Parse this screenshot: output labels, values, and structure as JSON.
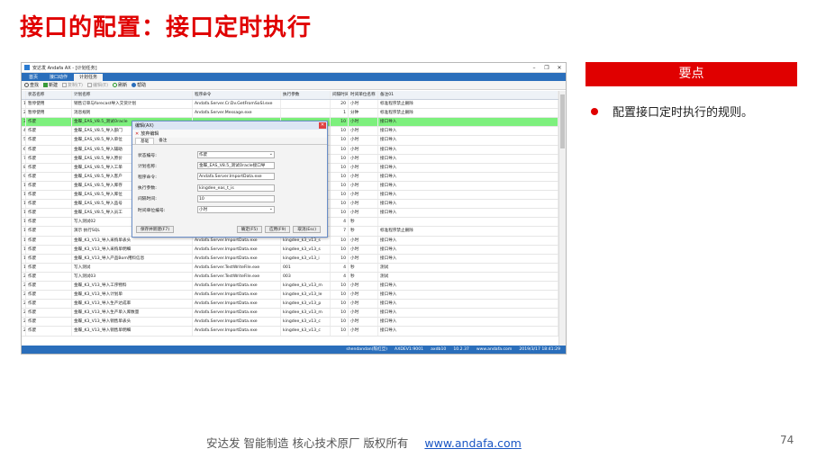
{
  "slide_title": "接口的配置：接口定时执行",
  "app": {
    "window_title": "安达发 Andafa AX - [计划任务]",
    "menu_tabs": [
      "首页",
      "接口动作",
      "计划任务"
    ],
    "toolbar": [
      "查找",
      "新建",
      "复制(T)",
      "编辑(E)",
      "刷新",
      "帮助"
    ],
    "columns": [
      "状态名称",
      "计划名称",
      "程序命令",
      "执行参数",
      "间隔时间",
      "时间单位名称",
      "备注01"
    ],
    "rows": [
      {
        "no": "1",
        "status": "暂停使用",
        "name": "销售订单与forecast导入交货计划",
        "cmd": "Andafa.Server.Cr.Dv.GetFromSoSI.exe",
        "param": "",
        "interval": "20",
        "unit": "小时",
        "note": "标准程序禁止删除"
      },
      {
        "no": "2",
        "status": "暂停使用",
        "name": "消息规则",
        "cmd": "Andafa.Server.Message.exe",
        "param": "",
        "interval": "1",
        "unit": "分钟",
        "note": "标准程序禁止删除"
      },
      {
        "no": "3",
        "status": "作废",
        "name": "金蝶_EAS_V8.5_测试Oracle",
        "cmd": "",
        "param": "",
        "interval": "10",
        "unit": "小时",
        "note": "接口导入"
      },
      {
        "no": "4",
        "status": "作废",
        "name": "金蝶_EAS_V8.5_导入部门",
        "cmd": "",
        "param": "",
        "interval": "10",
        "unit": "小时",
        "note": "接口导入"
      },
      {
        "no": "5",
        "status": "作废",
        "name": "金蝶_EAS_V8.5_导入单位",
        "cmd": "",
        "param": "",
        "interval": "10",
        "unit": "小时",
        "note": "接口导入"
      },
      {
        "no": "6",
        "status": "作废",
        "name": "金蝶_EAS_V8.5_导入辅助",
        "cmd": "",
        "param": "",
        "interval": "10",
        "unit": "小时",
        "note": "接口导入"
      },
      {
        "no": "7",
        "status": "作废",
        "name": "金蝶_EAS_V8.5_导入原价",
        "cmd": "",
        "param": "",
        "interval": "10",
        "unit": "小时",
        "note": "接口导入"
      },
      {
        "no": "8",
        "status": "作废",
        "name": "金蝶_EAS_V8.5_导入工单",
        "cmd": "",
        "param": "",
        "interval": "10",
        "unit": "小时",
        "note": "接口导入"
      },
      {
        "no": "9",
        "status": "作废",
        "name": "金蝶_EAS_V8.5_导入客户",
        "cmd": "",
        "param": "",
        "interval": "10",
        "unit": "小时",
        "note": "接口导入"
      },
      {
        "no": "10",
        "status": "作废",
        "name": "金蝶_EAS_V8.5_导入库存",
        "cmd": "",
        "param": "",
        "interval": "10",
        "unit": "小时",
        "note": "接口导入"
      },
      {
        "no": "11",
        "status": "作废",
        "name": "金蝶_EAS_V8.5_导入库位",
        "cmd": "",
        "param": "",
        "interval": "10",
        "unit": "小时",
        "note": "接口导入"
      },
      {
        "no": "12",
        "status": "作废",
        "name": "金蝶_EAS_V8.5_导入品号",
        "cmd": "",
        "param": "",
        "interval": "10",
        "unit": "小时",
        "note": "接口导入"
      },
      {
        "no": "13",
        "status": "作废",
        "name": "金蝶_EAS_V8.5_导入员工",
        "cmd": "",
        "param": "",
        "interval": "10",
        "unit": "小时",
        "note": "接口导入"
      },
      {
        "no": "14",
        "status": "作废",
        "name": "写入测试02",
        "cmd": "",
        "param": "",
        "interval": "4",
        "unit": "秒",
        "note": ""
      },
      {
        "no": "15",
        "status": "作废",
        "name": "演示 执行SQL",
        "cmd": "",
        "param": "",
        "interval": "7",
        "unit": "秒",
        "note": "标准程序禁止删除"
      },
      {
        "no": "16",
        "status": "作废",
        "name": "金蝶_K3_V13_导入采购单表头",
        "cmd": "Andafa.Server.ImportData.exe",
        "param": "kingdee_k3_v13_s",
        "interval": "10",
        "unit": "小时",
        "note": "接口导入"
      },
      {
        "no": "17",
        "status": "作废",
        "name": "金蝶_K3_V13_导入采购单明细",
        "cmd": "Andafa.Server.ImportData.exe",
        "param": "kingdee_k3_v13_s",
        "interval": "10",
        "unit": "小时",
        "note": "接口导入"
      },
      {
        "no": "18",
        "status": "作废",
        "name": "金蝶_K3_V13_导入产品Bom用料信息",
        "cmd": "Andafa.Server.ImportData.exe",
        "param": "kingdee_k3_v13_i",
        "interval": "10",
        "unit": "小时",
        "note": "接口导入"
      },
      {
        "no": "19",
        "status": "作废",
        "name": "写入测试",
        "cmd": "Andafa.Server.TestWriteFile.exe",
        "param": "001",
        "interval": "4",
        "unit": "秒",
        "note": "测试"
      },
      {
        "no": "20",
        "status": "作废",
        "name": "写入测试03",
        "cmd": "Andafa.Server.TestWriteFile.exe",
        "param": "003",
        "interval": "4",
        "unit": "秒",
        "note": "测试"
      },
      {
        "no": "21",
        "status": "作废",
        "name": "金蝶_K3_V13_导入工序物料",
        "cmd": "Andafa.Server.ImportData.exe",
        "param": "kingdee_k3_v13_m",
        "interval": "10",
        "unit": "小时",
        "note": "接口导入"
      },
      {
        "no": "22",
        "status": "作废",
        "name": "金蝶_K3_V13_导入计划单",
        "cmd": "Andafa.Server.ImportData.exe",
        "param": "kingdee_k3_v13_le",
        "interval": "10",
        "unit": "小时",
        "note": "接口导入"
      },
      {
        "no": "23",
        "status": "作废",
        "name": "金蝶_K3_V13_导入生产达成率",
        "cmd": "Andafa.Server.ImportData.exe",
        "param": "kingdee_k3_v13_p",
        "interval": "10",
        "unit": "小时",
        "note": "接口导入"
      },
      {
        "no": "24",
        "status": "作废",
        "name": "金蝶_K3_V13_导入生产单入库数量",
        "cmd": "Andafa.Server.ImportData.exe",
        "param": "kingdee_k3_v13_m",
        "interval": "10",
        "unit": "小时",
        "note": "接口导入"
      },
      {
        "no": "25",
        "status": "作废",
        "name": "金蝶_K3_V13_导入销售单表头",
        "cmd": "Andafa.Server.ImportData.exe",
        "param": "kingdee_k3_v13_c",
        "interval": "10",
        "unit": "小时",
        "note": "接口导入"
      },
      {
        "no": "26",
        "status": "作废",
        "name": "金蝶_K3_V13_导入销售单明细",
        "cmd": "Andafa.Server.ImportData.exe",
        "param": "kingdee_k3_v13_c",
        "interval": "10",
        "unit": "小时",
        "note": "接口导入"
      }
    ],
    "status_bar": [
      "shendandan(陈红旦)",
      "AXDEV1:9001",
      "axdb10",
      "10.2.37",
      "www.andafa.com",
      "2019/3/17 18:41:29"
    ],
    "dialog": {
      "title": "编辑(AX)",
      "toolbar_action": "放弃编辑",
      "tabs": [
        "基础",
        "备注"
      ],
      "fields": [
        {
          "label": "状态编号:",
          "value": "作废",
          "dropdown": true
        },
        {
          "label": "计划名称:",
          "value": "金蝶_EAS_V8.5_测试Oracle接口导",
          "dropdown": false
        },
        {
          "label": "程序命令:",
          "value": "Andafa.Server.ImportData.exe",
          "dropdown": false
        },
        {
          "label": "执行参数:",
          "value": "kingdee_eas_t_is",
          "dropdown": false
        },
        {
          "label": "间隔时间:",
          "value": "10",
          "dropdown": false
        },
        {
          "label": "时间单位编号:",
          "value": "小时",
          "dropdown": true
        }
      ],
      "buttons": [
        "保存并新建(F7)",
        "确定(F5)",
        "应用(F9)",
        "取消(Esc)"
      ]
    }
  },
  "right_panel": {
    "header": "要点",
    "bullet": "配置接口定时执行的规则。"
  },
  "footer": {
    "text": "安达发   智能制造 核心技术原厂   版权所有",
    "link": "www.andafa.com",
    "page": "74"
  },
  "colors": {
    "accent": "#e00000",
    "app_blue": "#2a6ebb",
    "selected_row": "#7df07d"
  }
}
